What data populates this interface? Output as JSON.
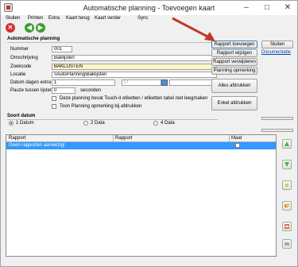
{
  "window": {
    "title": "Automatische planning - Toevoegen kaart",
    "minimize_glyph": "–",
    "maximize_glyph": "□",
    "close_glyph": "✕"
  },
  "menu": {
    "items": [
      "Sluiten",
      "Printen",
      "Extra",
      "Kaart terug",
      "Kaart verder",
      "Sync"
    ]
  },
  "toolbar": {
    "cancel_glyph": "✕",
    "back_glyph": "◀",
    "forward_glyph": "▶",
    "icons": [
      "cancel-icon",
      "back-arrow-icon",
      "forward-arrow-icon"
    ]
  },
  "form": {
    "group_title": "Automatische planning",
    "nummer_label": "Nummer",
    "nummer_value": "001",
    "omschrijving_label": "Omschrijving",
    "omschrijving_value": "Baklijsten",
    "zoekcode_label": "Zoekcode",
    "zoekcode_value": "BAKLIJSTEN",
    "locatie_label": "Locatie",
    "locatie_value": "\\\\AutoPlanning\\Baklijsten",
    "datum_label": "Datum dagen extra",
    "datum_value": "1",
    "datum_date_value": "/ /",
    "pauze_label": "Pauze tussen lijsten",
    "pauze_value": "0",
    "pauze_unit": "seconden",
    "check1_label": "Deze planning bevat Touch-it etiketten / etiketten tabel niet leegmaken",
    "check2_label": "Toon Planning opmerking bij afdrukken"
  },
  "sort": {
    "group_title": "Soort datum",
    "options": [
      "1 Datum",
      "2 Data",
      "4 Data"
    ],
    "selected": "1 Datum"
  },
  "buttons": {
    "rapport_toevoegen": "Rapport toevoegen",
    "rapport_wijzigen": "Rapport wijzigen",
    "rapport_verwijderen": "Rapport verwijderen",
    "planning_opmerking": "Planning opmerking",
    "alles_afdrukken": "Alles afdrukken",
    "enkel_afdrukken": "Enkel afdrukken",
    "sluiten": "Sluiten",
    "documentatie": "Documentatie"
  },
  "grid": {
    "columns": [
      "Rapport",
      "Rapport",
      "Maat"
    ],
    "rows": [
      [
        "Geen rapporten aanwezig!",
        "",
        ""
      ]
    ]
  },
  "side_buttons": [
    "move-up-icon",
    "move-down-icon",
    "export-icon",
    "copy-icon",
    "import-icon",
    "settings-icon"
  ],
  "colors": {
    "selection": "#3399ff",
    "zoekcode_bg": "#fbf6c6",
    "arrow": "#c0392b",
    "cancel": "#d32f2f",
    "nav": "#3b9f2f"
  }
}
